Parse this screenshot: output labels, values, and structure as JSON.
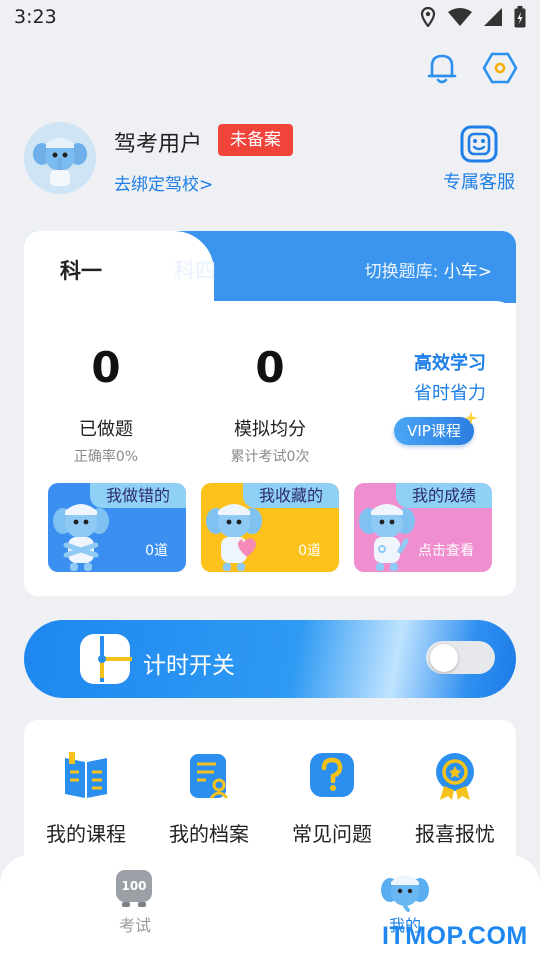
{
  "status_bar": {
    "time": "3:23"
  },
  "profile": {
    "username": "驾考用户",
    "badge": "未备案",
    "bind_link": "去绑定驾校>",
    "customer_service": "专属客服"
  },
  "subject_card": {
    "tabs": [
      {
        "label": "科一",
        "active": true
      },
      {
        "label": "科四",
        "active": false
      }
    ],
    "bank_switch_prefix": "切换题库:",
    "bank_switch_value": "小车>",
    "stats": [
      {
        "value": "0",
        "label": "已做题",
        "sub": "正确率0%"
      },
      {
        "value": "0",
        "label": "模拟均分",
        "sub": "累计考试0次"
      }
    ],
    "promo": {
      "line1": "高效学习",
      "line2": "省时省力",
      "vip_label": "VIP课程"
    },
    "mini_cards": [
      {
        "title": "我做错的",
        "value": "0道",
        "color": "#3b8ff0"
      },
      {
        "title": "我收藏的",
        "value": "0道",
        "color": "#fcc21b"
      },
      {
        "title": "我的成绩",
        "value": "点击查看",
        "color": "#f08fd0"
      }
    ]
  },
  "timer": {
    "label": "计时开关",
    "enabled": false
  },
  "features": [
    {
      "label": "我的课程",
      "icon": "course-icon"
    },
    {
      "label": "我的档案",
      "icon": "profile-file-icon"
    },
    {
      "label": "常见问题",
      "icon": "question-icon"
    },
    {
      "label": "报喜报忧",
      "icon": "medal-icon"
    }
  ],
  "bottom_nav": {
    "items": [
      {
        "label": "考试",
        "icon": "exam-score-icon",
        "active": false
      },
      {
        "label": "我的",
        "icon": "mascot-icon",
        "active": true
      }
    ],
    "exam_icon_text": "100"
  },
  "watermark": "ITMOP.COM"
}
